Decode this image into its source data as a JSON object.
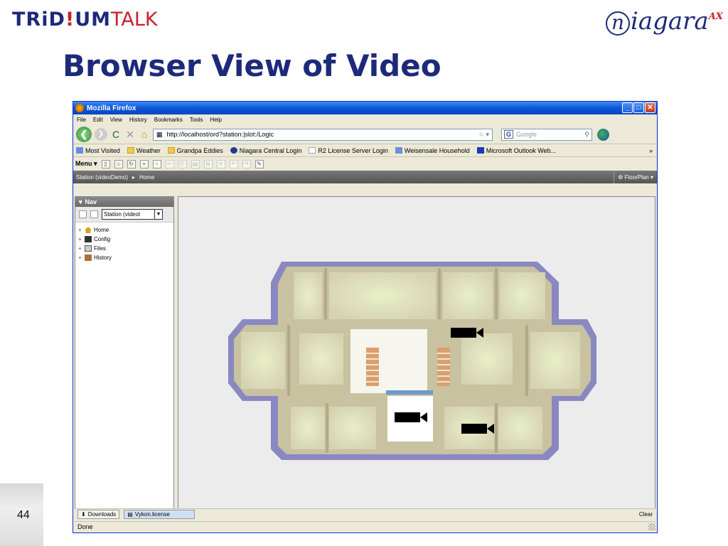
{
  "slide": {
    "logo_left_part1": "TRiD",
    "logo_left_excl": "!",
    "logo_left_part2": "UM",
    "logo_left_talk": "TALK",
    "logo_right_initial": "n",
    "logo_right_word": "iagara",
    "logo_right_super": "AX",
    "title": "Browser View of Video",
    "page_number": "44"
  },
  "window": {
    "title": "Mozilla Firefox",
    "minimize": "_",
    "maximize": "□",
    "close": "✕"
  },
  "menu": [
    "File",
    "Edit",
    "View",
    "History",
    "Bookmarks",
    "Tools",
    "Help"
  ],
  "navbar": {
    "back_glyph": "❮",
    "forward_glyph": "❯",
    "reload_glyph": "C",
    "stop_glyph": "✕",
    "home_glyph": "⌂",
    "url": "http://localhost/ord?station:|slot:/Logic",
    "url_star": "☆ ▾",
    "search_engine": "G",
    "search_placeholder": "Google",
    "search_glyph": "⚲"
  },
  "bookmarks": [
    {
      "label": "Most Visited",
      "icon": "blue"
    },
    {
      "label": "Weather",
      "icon": "folder"
    },
    {
      "label": "Grandpa Eddies",
      "icon": "folder"
    },
    {
      "label": "Niagara Central Login",
      "icon": "np"
    },
    {
      "label": "R2 License Server Login",
      "icon": "page"
    },
    {
      "label": "Weisensale Household",
      "icon": "blue"
    },
    {
      "label": "Microsoft Outlook Web...",
      "icon": "owa"
    }
  ],
  "bookmarks_more": "»",
  "workbench_toolbar": {
    "menu_label": "Menu ▾"
  },
  "locator": {
    "station": "Station (videoDemo)",
    "separator": "▸",
    "home": "Home",
    "view_selector": "⚙ FloorPlan ▾"
  },
  "nav_pane": {
    "header": "Nav",
    "station_select": "Station (videoI",
    "dropdown_glyph": "▼",
    "tree": [
      {
        "label": "Home",
        "icon": "home"
      },
      {
        "label": "Config",
        "icon": "cfg"
      },
      {
        "label": "Files",
        "icon": "files"
      },
      {
        "label": "History",
        "icon": "hist"
      }
    ],
    "expander": "+"
  },
  "downloads": {
    "downloads_label": "Downloads",
    "file_label": "Vykon.license",
    "clear_label": "Clear"
  },
  "status": {
    "text": "Done"
  }
}
